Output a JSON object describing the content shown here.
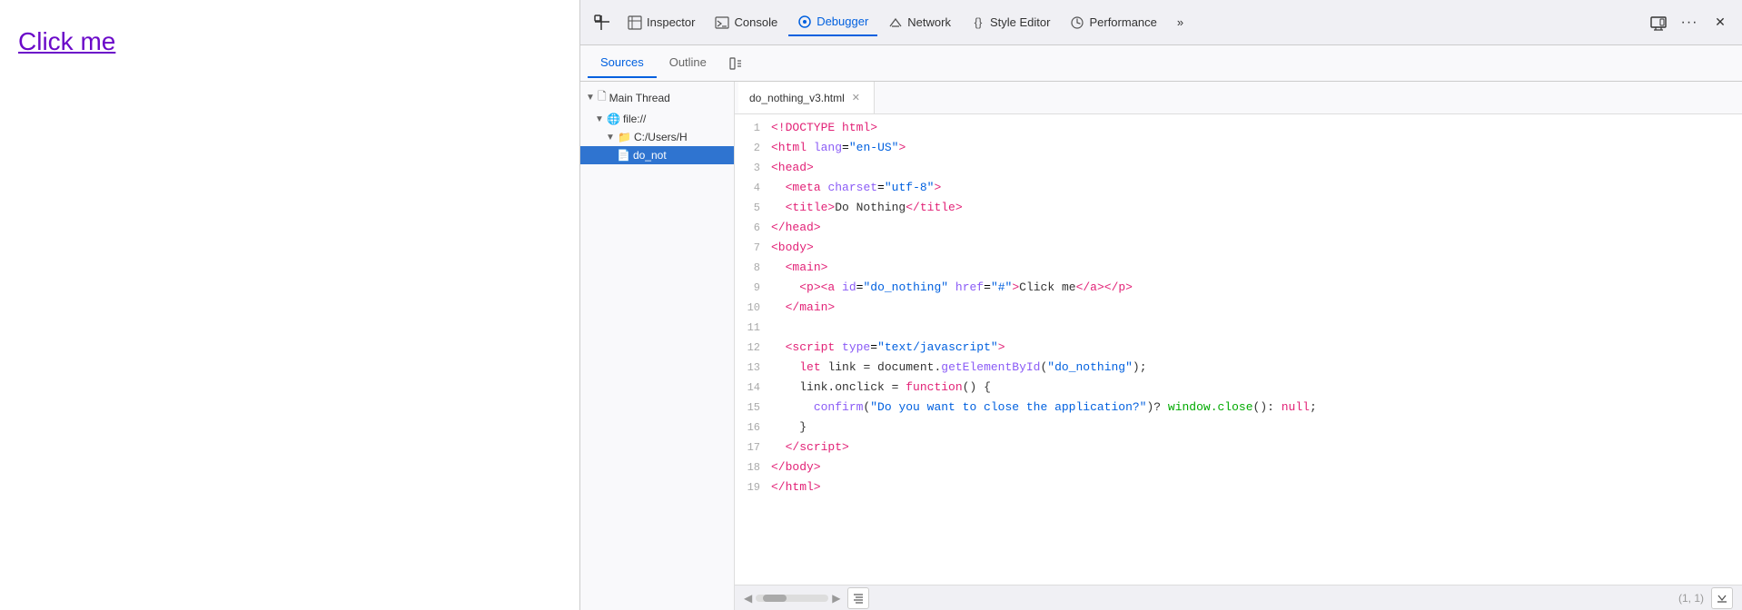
{
  "page": {
    "click_me_text": "Click me"
  },
  "devtools": {
    "toolbar": {
      "pick_icon": "⬚",
      "inspector_label": "Inspector",
      "console_label": "Console",
      "debugger_label": "Debugger",
      "network_label": "Network",
      "style_editor_label": "Style Editor",
      "performance_label": "Performance",
      "more_label": "»",
      "responsive_icon": "⊡",
      "options_icon": "···",
      "close_icon": "✕"
    },
    "subtabs": {
      "sources_label": "Sources",
      "outline_label": "Outline"
    },
    "file_tree": {
      "main_thread": "Main Thread",
      "file_url": "file://",
      "folder": "C:/Users/H",
      "file": "do_not"
    },
    "file_tab": {
      "name": "do_nothing_v3.html",
      "close": "✕"
    },
    "code_lines": [
      {
        "num": 1,
        "html": "&lt;!DOCTYPE html&gt;",
        "type": "tag"
      },
      {
        "num": 2,
        "html": "&lt;html lang=\"en-US\"&gt;",
        "type": "tag_attr"
      },
      {
        "num": 3,
        "html": "&lt;head&gt;",
        "type": "tag"
      },
      {
        "num": 4,
        "html": "  &lt;meta charset=\"utf-8\"&gt;",
        "type": "tag_attr"
      },
      {
        "num": 5,
        "html": "  &lt;title&gt;Do Nothing&lt;/title&gt;",
        "type": "tag_text"
      },
      {
        "num": 6,
        "html": "&lt;/head&gt;",
        "type": "tag"
      },
      {
        "num": 7,
        "html": "&lt;body&gt;",
        "type": "tag"
      },
      {
        "num": 8,
        "html": "  &lt;main&gt;",
        "type": "tag"
      },
      {
        "num": 9,
        "html": "    &lt;p&gt;&lt;a id=\"do_nothing\" href=\"#\"&gt;Click me&lt;/a&gt;&lt;/p&gt;",
        "type": "mixed"
      },
      {
        "num": 10,
        "html": "  &lt;/main&gt;",
        "type": "tag"
      },
      {
        "num": 11,
        "html": "",
        "type": "empty"
      },
      {
        "num": 12,
        "html": "  &lt;script type=\"text/javascript\"&gt;",
        "type": "tag_attr"
      },
      {
        "num": 13,
        "html": "    let link = document.getElementById(\"do_nothing\");",
        "type": "js"
      },
      {
        "num": 14,
        "html": "    link.onclick = function() {",
        "type": "js"
      },
      {
        "num": 15,
        "html": "      confirm(\"Do you want to close the application?\")? window.close(): null;",
        "type": "js_confirm"
      },
      {
        "num": 16,
        "html": "    }",
        "type": "js"
      },
      {
        "num": 17,
        "html": "  &lt;/script&gt;",
        "type": "tag"
      },
      {
        "num": 18,
        "html": "&lt;/body&gt;",
        "type": "tag"
      },
      {
        "num": 19,
        "html": "&lt;/html&gt;",
        "type": "tag"
      }
    ],
    "statusbar": {
      "cursor_pos": "(1, 1)"
    }
  }
}
